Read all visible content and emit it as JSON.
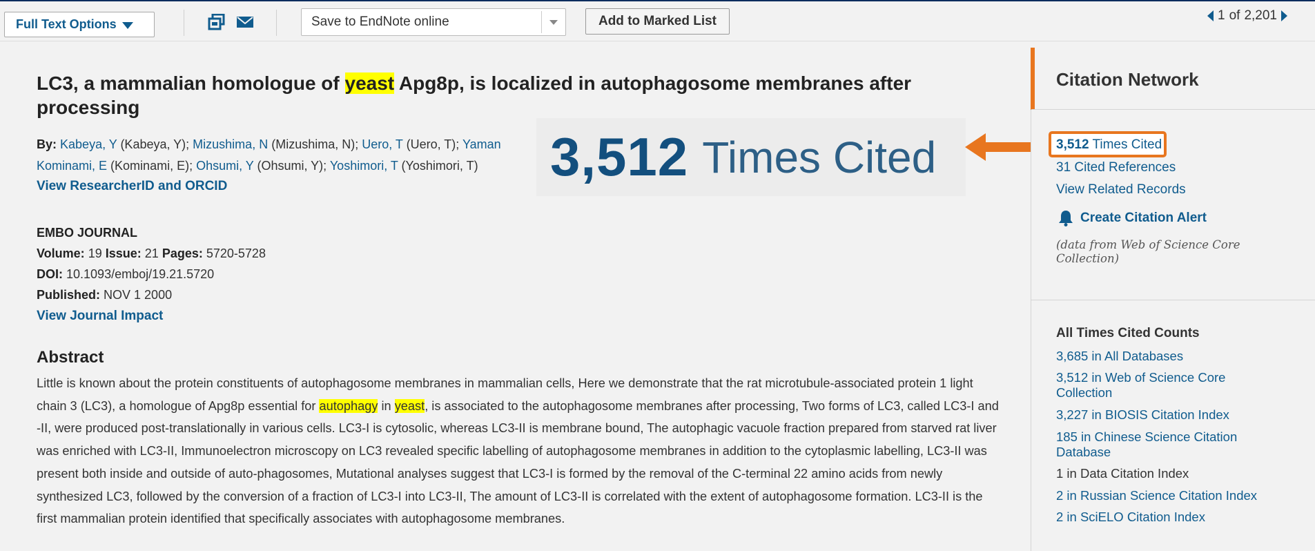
{
  "toolbar": {
    "full_text_label": "Full Text Options",
    "save_select_value": "Save to EndNote online",
    "add_marked_label": "Add to Marked List",
    "pager_current": "1",
    "pager_of": "of",
    "pager_total": "2,201"
  },
  "record": {
    "title_pre": "LC3, a mammalian homologue of ",
    "title_hl": "yeast",
    "title_post": " Apg8p, is localized in autophagosome membranes after processing",
    "by_label": "By:",
    "authors": [
      {
        "name": "Kabeya, Y",
        "full": " (Kabeya, Y); "
      },
      {
        "name": "Mizushima, N",
        "full": " (Mizushima, N); "
      },
      {
        "name": "Uero, T",
        "full": " (Uero, T); "
      },
      {
        "name": "Yaman",
        "full": ""
      },
      {
        "name": "Kominami, E",
        "full": " (Kominami, E); "
      },
      {
        "name": "Ohsumi, Y",
        "full": " (Ohsumi, Y); "
      },
      {
        "name": "Yoshimori, T",
        "full": " (Yoshimori, T)"
      }
    ],
    "view_researcher": "View ResearcherID and ORCID",
    "journal": "EMBO JOURNAL",
    "volume_label": "Volume:",
    "volume": "19",
    "issue_label": "Issue:",
    "issue": "21",
    "pages_label": "Pages:",
    "pages": "5720-5728",
    "doi_label": "DOI:",
    "doi": "10.1093/emboj/19.21.5720",
    "published_label": "Published:",
    "published": "NOV 1 2000",
    "view_journal_impact": "View Journal Impact",
    "abstract_heading": "Abstract",
    "abstract_p1": "Little is known about the protein constituents of autophagosome membranes in mammalian cells, Here we demonstrate that the rat microtubule-associated protein 1 light chain 3 (LC3), a homologue of Apg8p essential for ",
    "abstract_hl1": "autophagy",
    "abstract_p2": " in ",
    "abstract_hl2": "yeast",
    "abstract_p3": ", is associated to the autophagosome membranes after processing, Two forms of LC3, called LC3-I and -II, were produced post-translationally in various cells. LC3-I is cytosolic, whereas LC3-II is membrane bound, The autophagic vacuole fraction prepared from starved rat liver was enriched with LC3-II, Immunoelectron microscopy on LC3 revealed specific labelling of autophagosome membranes in addition to the cytoplasmic labelling, LC3-II was present both inside and outside of auto-phagosomes, Mutational analyses suggest that LC3-I is formed by the removal of the C-terminal 22 amino acids from newly synthesized LC3, followed by the conversion of a fraction of LC3-I into LC3-II, The amount of LC3-II is correlated with the extent of autophagosome formation. LC3-II is the first mammalian protein identified that specifically associates with autophagosome membranes."
  },
  "zoom_callout": {
    "number": "3,512",
    "text": "Times Cited"
  },
  "sidebar": {
    "heading": "Citation Network",
    "times_cited_num": "3,512",
    "times_cited_label": "Times Cited",
    "cited_references": "31 Cited References",
    "view_related": "View Related Records",
    "create_alert": "Create Citation Alert",
    "data_note": "(data from Web of Science Core Collection)",
    "counts_heading": "All Times Cited Counts",
    "counts": [
      "3,685 in All Databases",
      "3,512 in Web of Science Core Collection",
      "3,227 in BIOSIS Citation Index",
      "185 in Chinese Science Citation Database",
      "1 in Data Citation Index",
      "2 in Russian Science Citation Index",
      "2 in SciELO Citation Index"
    ]
  },
  "colors": {
    "link": "#105c8e",
    "accent": "#e8761f",
    "highlight": "#ffff00"
  },
  "icons": [
    "print-icon",
    "email-icon",
    "bell-icon",
    "arrow-left-icon"
  ]
}
